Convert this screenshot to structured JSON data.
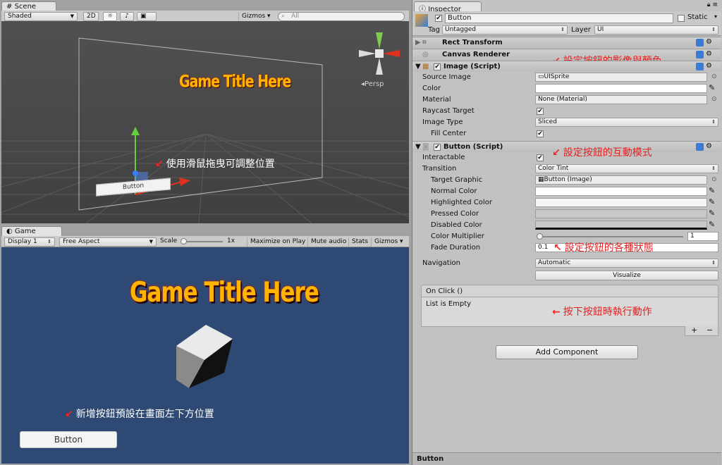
{
  "scene": {
    "tab": "Scene",
    "shading": "Shaded",
    "btn_2d": "2D",
    "gizmos": "Gizmos",
    "search_placeholder": "All",
    "persp": "Persp",
    "title_text": "Game Title Here",
    "button_label": "Button",
    "annotation": "使用滑鼠拖曳可調整位置"
  },
  "game": {
    "tab": "Game",
    "display": "Display 1",
    "aspect": "Free Aspect",
    "scale_label": "Scale",
    "scale_value": "1x",
    "maximize": "Maximize on Play",
    "mute": "Mute audio",
    "stats": "Stats",
    "gizmos": "Gizmos",
    "title_text": "Game Title Here",
    "button_label": "Button",
    "annotation": "新增按鈕預設在畫面左下方位置"
  },
  "inspector": {
    "tab": "Inspector",
    "object_name": "Button",
    "static_label": "Static",
    "tag_label": "Tag",
    "tag_value": "Untagged",
    "layer_label": "Layer",
    "layer_value": "UI",
    "components": {
      "rect_transform": "Rect Transform",
      "canvas_renderer": "Canvas Renderer",
      "image": "Image (Script)",
      "button": "Button (Script)"
    },
    "image": {
      "source_image_label": "Source Image",
      "source_image_value": "UISprite",
      "color_label": "Color",
      "material_label": "Material",
      "material_value": "None (Material)",
      "raycast_label": "Raycast Target",
      "image_type_label": "Image Type",
      "image_type_value": "Sliced",
      "fill_center_label": "Fill Center"
    },
    "button": {
      "interactable_label": "Interactable",
      "transition_label": "Transition",
      "transition_value": "Color Tint",
      "target_graphic_label": "Target Graphic",
      "target_graphic_value": "Button (Image)",
      "normal_color_label": "Normal Color",
      "highlighted_color_label": "Highlighted Color",
      "pressed_color_label": "Pressed Color",
      "disabled_color_label": "Disabled Color",
      "color_multiplier_label": "Color Multiplier",
      "color_multiplier_value": "1",
      "fade_duration_label": "Fade Duration",
      "fade_duration_value": "0.1",
      "navigation_label": "Navigation",
      "navigation_value": "Automatic",
      "visualize": "Visualize",
      "onclick_header": "On Click ()",
      "onclick_empty": "List is Empty",
      "plus": "+",
      "minus": "−"
    },
    "add_component": "Add Component",
    "bottom_label": "Button",
    "annotations": {
      "image_note": "設定按鈕的影像與顏色",
      "button_note": "設定按鈕的互動模式",
      "state_note": "設定按鈕的各種狀態",
      "onclick_note": "按下按鈕時執行動作"
    }
  },
  "colors": {
    "game_bg": "#2e4a74",
    "annotation_red": "#e82020",
    "title_orange": "#ffb400"
  }
}
